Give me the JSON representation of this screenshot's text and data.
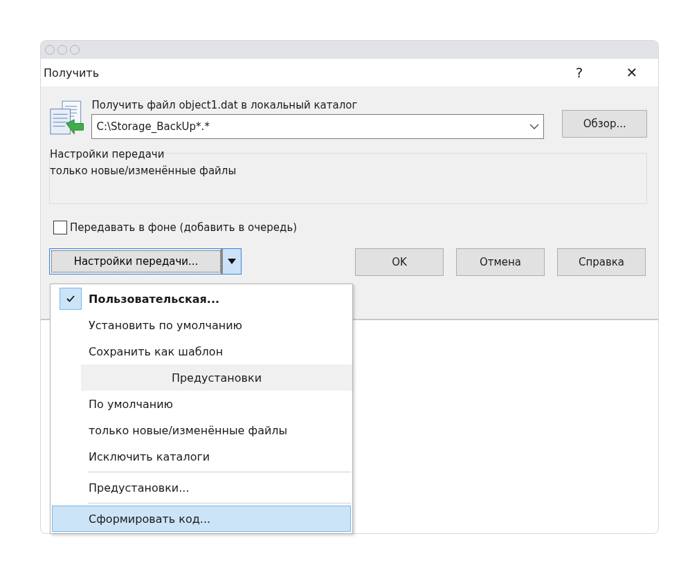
{
  "window": {
    "title": "Получить",
    "help": "?",
    "close": "✕"
  },
  "target": {
    "label": "Получить файл object1.dat в локальный каталог",
    "value": "C:\\Storage_BackUp*.*",
    "browse": "Обзор..."
  },
  "transfer_settings": {
    "legend": "Настройки передачи",
    "value": "только новые/изменённые файлы"
  },
  "background_checkbox": {
    "label": "Передавать в фоне (добавить в очередь)",
    "checked": false
  },
  "settings_button": {
    "label": "Настройки передачи...",
    "expanded": true
  },
  "buttons": [
    "OK",
    "Отмена",
    "Справка"
  ],
  "menu": [
    {
      "kind": "item",
      "label": "Пользовательская...",
      "checked": true,
      "selected": false
    },
    {
      "kind": "item",
      "label": "Установить по умолчанию",
      "checked": false,
      "selected": false
    },
    {
      "kind": "item",
      "label": "Сохранить как шаблон",
      "checked": false,
      "selected": false
    },
    {
      "kind": "header",
      "label": "Предустановки"
    },
    {
      "kind": "item",
      "label": "По умолчанию",
      "checked": false,
      "selected": false
    },
    {
      "kind": "item",
      "label": "только новые/изменённые файлы",
      "checked": false,
      "selected": false
    },
    {
      "kind": "item",
      "label": "Исключить каталоги",
      "checked": false,
      "selected": false
    },
    {
      "kind": "separator"
    },
    {
      "kind": "item",
      "label": "Предустановки...",
      "checked": false,
      "selected": false
    },
    {
      "kind": "separator"
    },
    {
      "kind": "item",
      "label": "Сформировать код...",
      "checked": false,
      "selected": true
    }
  ]
}
